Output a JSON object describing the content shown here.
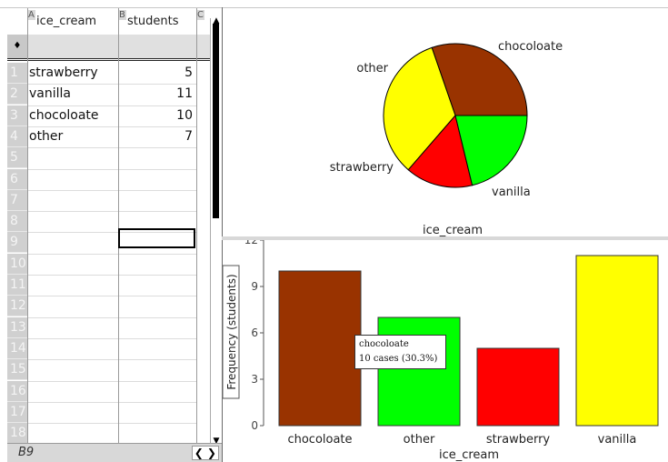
{
  "spreadsheet": {
    "columns": [
      {
        "letter": "A",
        "name": "ice_cream"
      },
      {
        "letter": "B",
        "name": "students"
      },
      {
        "letter": "C",
        "name": ""
      }
    ],
    "formula_row_marker": "♦",
    "rows": [
      {
        "num": "1",
        "a": "strawberry",
        "b": "5"
      },
      {
        "num": "2",
        "a": "vanilla",
        "b": "11"
      },
      {
        "num": "3",
        "a": "chocoloate",
        "b": "10"
      },
      {
        "num": "4",
        "a": "other",
        "b": "7"
      },
      {
        "num": "5",
        "a": "",
        "b": ""
      },
      {
        "num": "6",
        "a": "",
        "b": ""
      },
      {
        "num": "7",
        "a": "",
        "b": ""
      },
      {
        "num": "8",
        "a": "",
        "b": ""
      },
      {
        "num": "9",
        "a": "",
        "b": ""
      },
      {
        "num": "10",
        "a": "",
        "b": ""
      },
      {
        "num": "11",
        "a": "",
        "b": ""
      },
      {
        "num": "12",
        "a": "",
        "b": ""
      },
      {
        "num": "13",
        "a": "",
        "b": ""
      },
      {
        "num": "14",
        "a": "",
        "b": ""
      },
      {
        "num": "15",
        "a": "",
        "b": ""
      },
      {
        "num": "16",
        "a": "",
        "b": ""
      },
      {
        "num": "17",
        "a": "",
        "b": ""
      },
      {
        "num": "18",
        "a": "",
        "b": ""
      }
    ],
    "selected_cell": "B9",
    "scroll_arrows": "❮ ❯",
    "scroll_up": "▲",
    "scroll_down": "▼"
  },
  "tooltip": {
    "line1": "chocoloate",
    "line2": "10 cases (30.3%)"
  },
  "chart_data": [
    {
      "type": "pie",
      "categories": [
        "chocoloate",
        "vanilla",
        "strawberry",
        "other"
      ],
      "values": [
        10,
        11,
        5,
        7
      ],
      "colors": [
        "#993300",
        "#ffff00",
        "#ff0000",
        "#00ff00"
      ],
      "xlabel": "ice_cream"
    },
    {
      "type": "bar",
      "categories": [
        "chocoloate",
        "other",
        "strawberry",
        "vanilla"
      ],
      "values": [
        10,
        7,
        5,
        11
      ],
      "colors": [
        "#993300",
        "#00ff00",
        "#ff0000",
        "#ffff00"
      ],
      "xlabel": "ice_cream",
      "ylabel": "Frequency (students)",
      "ylim": [
        0,
        12
      ],
      "yticks": [
        0,
        3,
        6,
        9,
        12
      ]
    }
  ]
}
